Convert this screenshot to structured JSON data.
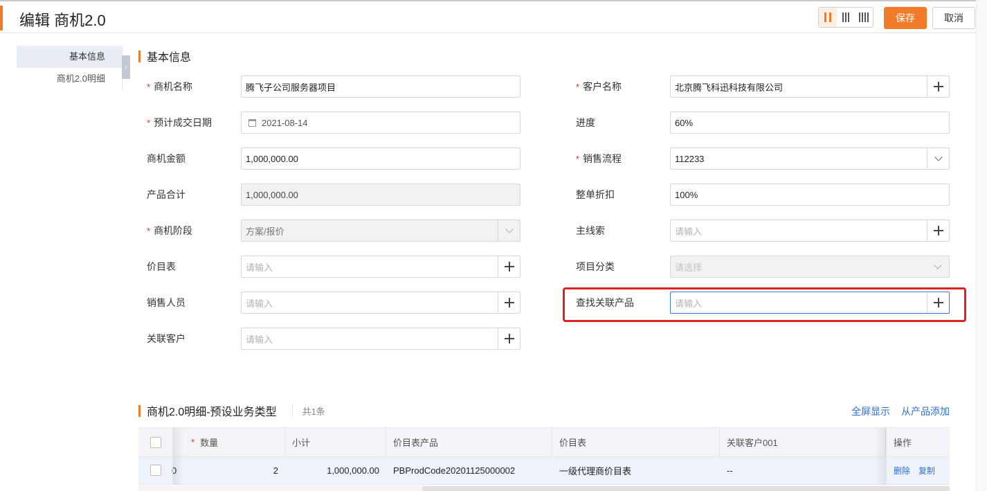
{
  "header": {
    "title": "编辑 商机2.0",
    "save_label": "保存",
    "cancel_label": "取消",
    "layout_options": [
      "two-column-icon",
      "three-column-icon",
      "four-column-icon"
    ]
  },
  "sidenav": {
    "items": [
      {
        "label": "基本信息",
        "active": true
      },
      {
        "label": "商机2.0明细",
        "active": false
      }
    ]
  },
  "basic_section": {
    "title": "基本信息",
    "left_fields": [
      {
        "label": "商机名称",
        "required": true,
        "value": "腾飞子公司服务器项目",
        "placeholder": ""
      },
      {
        "label": "预计成交日期",
        "required": true,
        "value": "2021-08-14",
        "placeholder": ""
      },
      {
        "label": "商机金额",
        "required": false,
        "value": "1,000,000.00",
        "placeholder": ""
      },
      {
        "label": "产品合计",
        "required": false,
        "value": "1,000,000.00",
        "placeholder": ""
      },
      {
        "label": "商机阶段",
        "required": true,
        "value": "方案/报价",
        "placeholder": ""
      },
      {
        "label": "价目表",
        "required": false,
        "value": "",
        "placeholder": "请输入"
      },
      {
        "label": "销售人员",
        "required": false,
        "value": "",
        "placeholder": "请输入"
      },
      {
        "label": "关联客户",
        "required": false,
        "value": "",
        "placeholder": "请输入"
      }
    ],
    "right_fields": [
      {
        "label": "客户名称",
        "required": true,
        "value": "北京腾飞科迅科技有限公司",
        "placeholder": ""
      },
      {
        "label": "进度",
        "required": false,
        "value": "60%",
        "placeholder": ""
      },
      {
        "label": "销售流程",
        "required": true,
        "value": "112233",
        "placeholder": ""
      },
      {
        "label": "整单折扣",
        "required": false,
        "value": "100%",
        "placeholder": ""
      },
      {
        "label": "主线索",
        "required": false,
        "value": "",
        "placeholder": "请输入"
      },
      {
        "label": "项目分类",
        "required": false,
        "value": "",
        "placeholder": "请选择"
      },
      {
        "label": "查找关联产品",
        "required": false,
        "value": "",
        "placeholder": "请输入"
      }
    ]
  },
  "detail_section": {
    "title": "商机2.0明细-预设业务类型",
    "count": "共1条",
    "fullscreen_label": "全屏显示",
    "add_from_product_label": "从产品添加",
    "columns": [
      "数量",
      "小计",
      "价目表产品",
      "价目表",
      "关联客户001",
      "操作"
    ],
    "rows": [
      {
        "cut_value": "0",
        "quantity": "2",
        "subtotal": "1,000,000.00",
        "price_product": "PBProdCode20201125000002",
        "price_list": "一级代理商价目表",
        "related_customer": "--",
        "delete_label": "删除",
        "copy_label": "复制"
      }
    ]
  },
  "colors": {
    "accent": "#f07c2b",
    "link": "#2f6fcf",
    "required": "#e5302d",
    "highlight": "#e02020"
  }
}
